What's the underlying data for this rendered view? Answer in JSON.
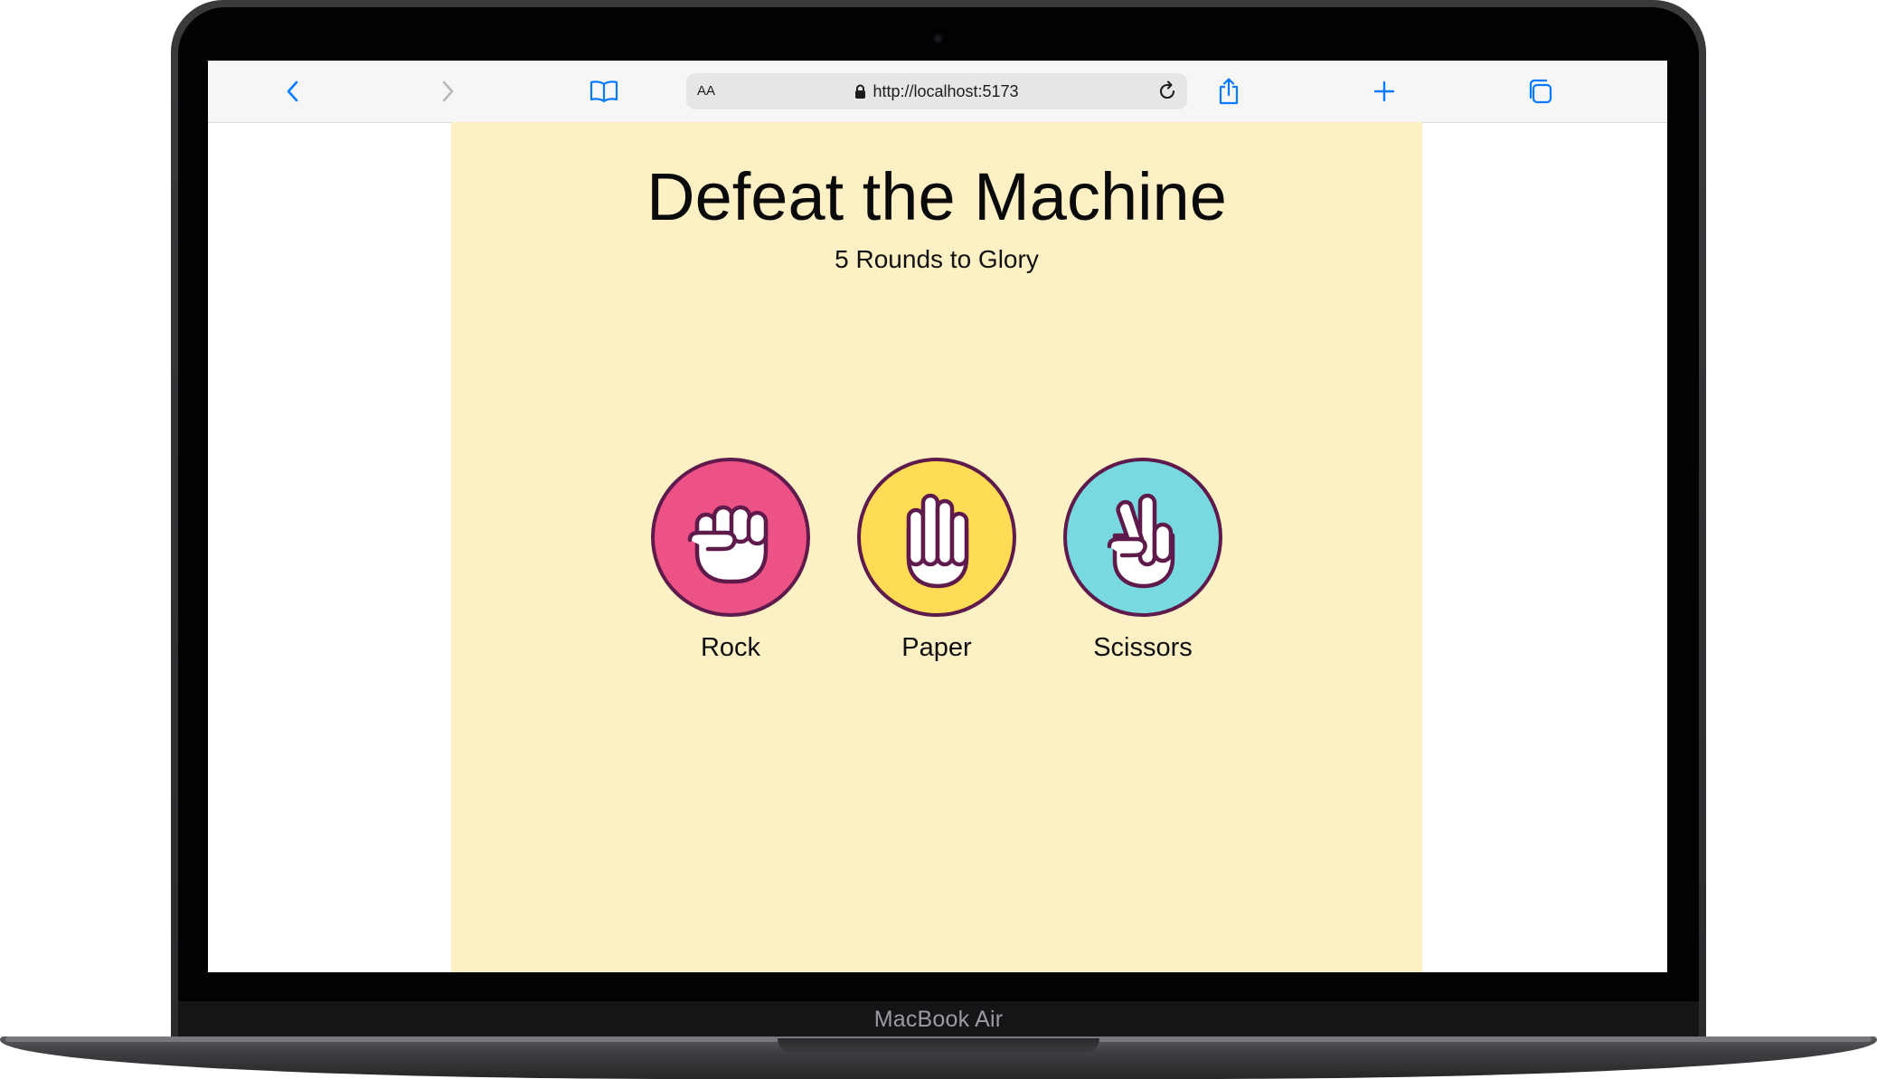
{
  "device": {
    "brand_label": "MacBook Air"
  },
  "browser": {
    "text_size_label": "AA",
    "url": "http://localhost:5173",
    "icons": [
      "chevron-left-icon",
      "chevron-right-icon",
      "book-icon",
      "lock-icon",
      "reload-icon",
      "share-icon",
      "plus-icon",
      "tabs-icon"
    ],
    "accent_color": "#0a7aff"
  },
  "game": {
    "title": "Defeat the Machine",
    "subtitle": "5 Rounds to Glory",
    "background_color": "#fdf0c4",
    "outline_color": "#5e1a4b",
    "choices": [
      {
        "label": "Rock",
        "color": "#ec5286",
        "icon": "rock-fist-icon"
      },
      {
        "label": "Paper",
        "color": "#ffdc55",
        "icon": "paper-hand-icon"
      },
      {
        "label": "Scissors",
        "color": "#78dae0",
        "icon": "scissors-hand-icon"
      }
    ]
  }
}
